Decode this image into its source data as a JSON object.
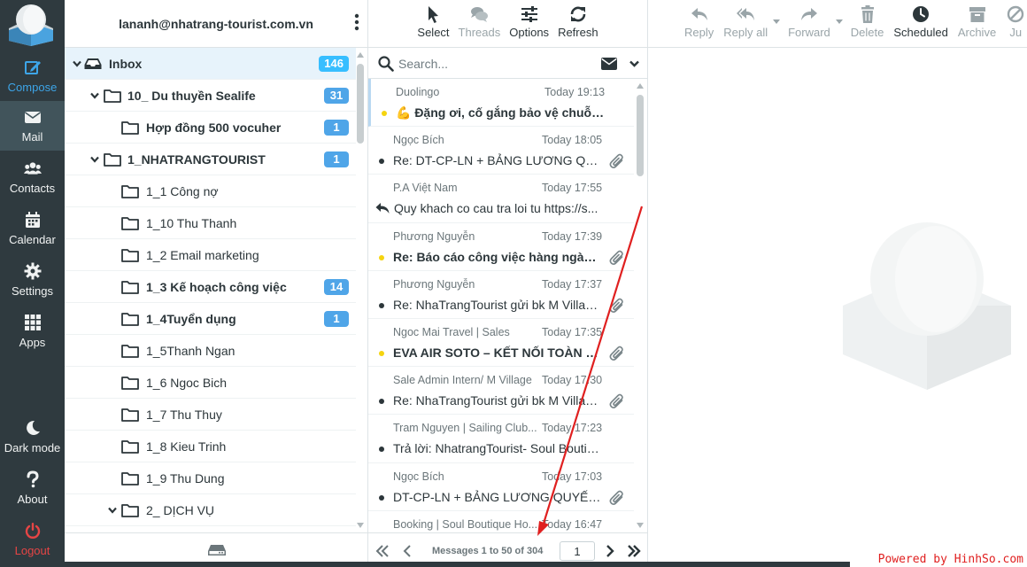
{
  "account": {
    "email": "lananh@nhatrang-tourist.com.vn"
  },
  "nav": {
    "compose": "Compose",
    "mail": "Mail",
    "contacts": "Contacts",
    "calendar": "Calendar",
    "settings": "Settings",
    "apps": "Apps",
    "dark_mode": "Dark mode",
    "about": "About",
    "logout": "Logout"
  },
  "folders": [
    {
      "name": "Inbox",
      "count": "146",
      "bold": true,
      "level": 0,
      "expanded": true,
      "icon": "inbox-icon",
      "selected": true
    },
    {
      "name": "10_ Du thuyền Sealife",
      "count": "31",
      "bold": true,
      "level": 1,
      "expanded": true,
      "icon": "folder-icon"
    },
    {
      "name": "Hợp đồng 500 vocuher",
      "count": "1",
      "bold": true,
      "level": 2,
      "icon": "folder-icon"
    },
    {
      "name": "1_NHATRANGTOURIST",
      "count": "1",
      "bold": true,
      "level": 1,
      "expanded": true,
      "icon": "folder-icon"
    },
    {
      "name": "1_1 Công nợ",
      "count": "",
      "bold": false,
      "level": 2,
      "icon": "folder-icon"
    },
    {
      "name": "1_10 Thu Thanh",
      "count": "",
      "bold": false,
      "level": 2,
      "icon": "folder-icon"
    },
    {
      "name": "1_2 Email marketing",
      "count": "",
      "bold": false,
      "level": 2,
      "icon": "folder-icon"
    },
    {
      "name": "1_3 Kế hoạch công việc",
      "count": "14",
      "bold": true,
      "level": 2,
      "icon": "folder-icon"
    },
    {
      "name": "1_4Tuyển dụng",
      "count": "1",
      "bold": true,
      "level": 2,
      "icon": "folder-icon"
    },
    {
      "name": "1_5Thanh Ngan",
      "count": "",
      "bold": false,
      "level": 2,
      "icon": "folder-icon"
    },
    {
      "name": "1_6 Ngoc Bich",
      "count": "",
      "bold": false,
      "level": 2,
      "icon": "folder-icon"
    },
    {
      "name": "1_7 Thu Thuy",
      "count": "",
      "bold": false,
      "level": 2,
      "icon": "folder-icon"
    },
    {
      "name": "1_8 Kieu Trinh",
      "count": "",
      "bold": false,
      "level": 2,
      "icon": "folder-icon"
    },
    {
      "name": "1_9 Thu Dung",
      "count": "",
      "bold": false,
      "level": 2,
      "icon": "folder-icon"
    },
    {
      "name": "2_ DỊCH VỤ",
      "count": "",
      "bold": false,
      "level": 2,
      "expanded": true,
      "icon": "folder-icon"
    }
  ],
  "list_toolbar": {
    "select": "Select",
    "threads": "Threads",
    "options": "Options",
    "refresh": "Refresh"
  },
  "search": {
    "placeholder": "Search..."
  },
  "messages": [
    {
      "from": "Duolingo",
      "date": "Today 19:13",
      "subject": "💪 Đặng ơi, cố gắng bảo vệ chuỗi 1...",
      "unread": true,
      "flag": true,
      "attachment": false,
      "replied": false
    },
    {
      "from": "Ngọc Bích",
      "date": "Today 18:05",
      "subject": "Re: DT-CP-LN + BẢNG LƯƠNG QUYẾ...",
      "unread": false,
      "flag": false,
      "attachment": true,
      "replied": false
    },
    {
      "from": "P.A Việt Nam",
      "date": "Today 17:55",
      "subject": "Quy khach co cau tra loi tu https://s...",
      "unread": false,
      "flag": false,
      "attachment": false,
      "replied": true
    },
    {
      "from": "Phương Nguyễn",
      "date": "Today 17:39",
      "subject": "Re: Báo cáo công việc hàng ngày 1...",
      "unread": true,
      "flag": true,
      "attachment": true,
      "replied": false
    },
    {
      "from": "Phương Nguyễn",
      "date": "Today 17:37",
      "subject": "Re: NhaTrangTourist gửi bk M Villag...",
      "unread": false,
      "flag": false,
      "attachment": true,
      "replied": false
    },
    {
      "from": "Ngoc Mai Travel | Sales",
      "date": "Today 17:35",
      "subject": "EVA AIR SOTO – KẾT NỐI TOÀN CẦ...",
      "unread": true,
      "flag": true,
      "attachment": true,
      "replied": false
    },
    {
      "from": "Sale Admin Intern/ M Village",
      "date": "Today 17:30",
      "subject": "Re: NhaTrangTourist gửi bk M Villag...",
      "unread": false,
      "flag": false,
      "attachment": true,
      "replied": false
    },
    {
      "from": "Tram Nguyen | Sailing Club...",
      "date": "Today 17:23",
      "subject": "Trả lời: NhatrangTourist- Soul Boutiq...",
      "unread": false,
      "flag": false,
      "attachment": false,
      "replied": false
    },
    {
      "from": "Ngọc Bích",
      "date": "Today 17:03",
      "subject": "DT-CP-LN + BẢNG LƯƠNG QUYẾT T...",
      "unread": false,
      "flag": false,
      "attachment": true,
      "replied": false
    },
    {
      "from": "Booking | Soul Boutique Ho...",
      "date": "Today 16:47",
      "subject": "",
      "unread": false,
      "flag": false,
      "attachment": false,
      "replied": false
    }
  ],
  "pagination": {
    "text": "Messages 1 to 50 of 304",
    "page": "1"
  },
  "reader_toolbar": {
    "reply": "Reply",
    "reply_all": "Reply all",
    "forward": "Forward",
    "delete": "Delete",
    "scheduled": "Scheduled",
    "archive": "Archive",
    "junk": "Ju"
  },
  "footer": {
    "powered": "Powered by HinhSo.com"
  },
  "colors": {
    "nav_bg": "#2f3a3f",
    "accent": "#37a4e6",
    "logout": "#e64545",
    "badge": "#4fa5e8",
    "annotation_arrow": "#e02020"
  }
}
